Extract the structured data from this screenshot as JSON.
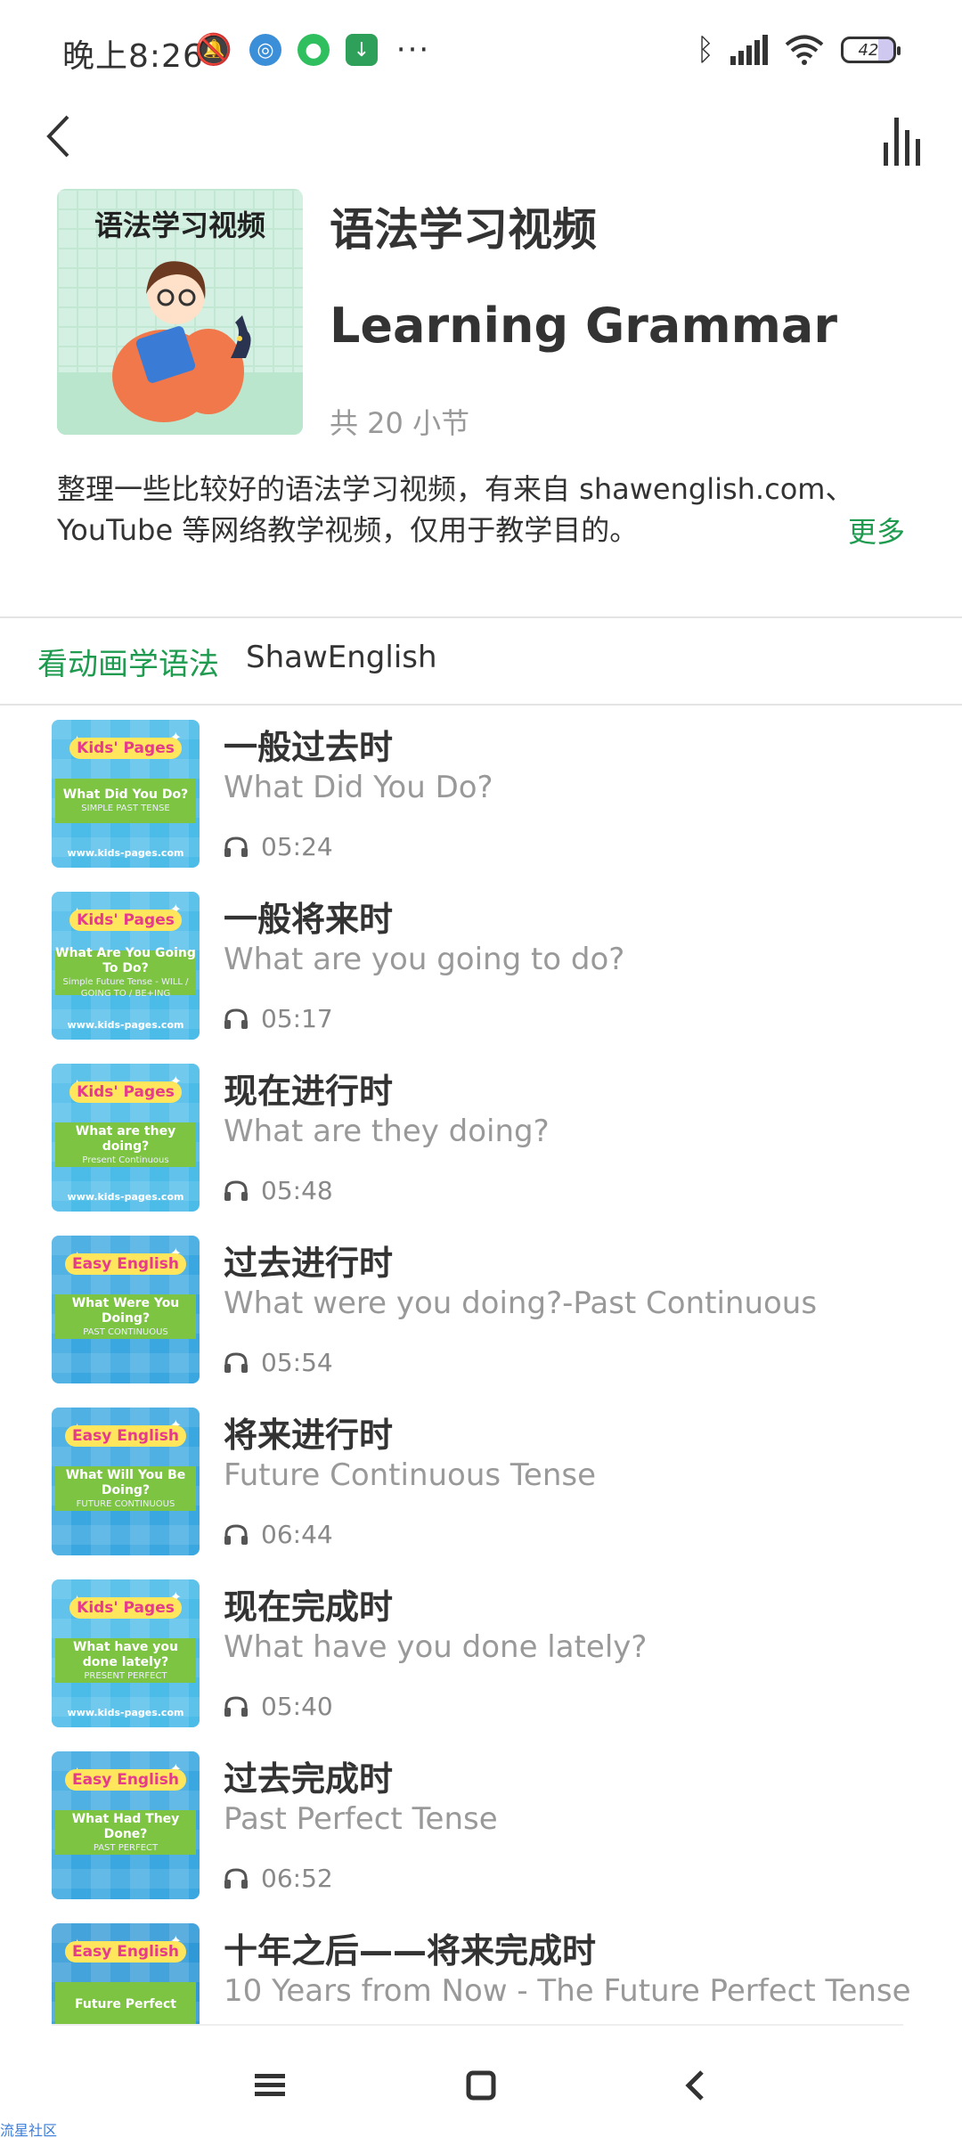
{
  "status_bar": {
    "time": "晚上8:26",
    "battery": "42",
    "icons_left": [
      "mute-icon",
      "browser-icon",
      "wechat-icon",
      "download-icon",
      "more-dots-icon"
    ],
    "icons_right": [
      "bluetooth-icon",
      "hd-signal-icon",
      "wifi-icon",
      "battery-icon"
    ]
  },
  "nav": {
    "back_icon": "chevron-left-icon",
    "player_icon": "equalizer-icon"
  },
  "course": {
    "cover_text": "语法学习视频",
    "title_cn": "语法学习视频",
    "title_en": "Learning Grammar",
    "lesson_count": "共 20 小节",
    "description": "整理一些比较好的语法学习视频，有来自 shawenglish.com、YouTube 等网络教学视频，仅用于教学目的。",
    "more": "更多"
  },
  "tabs": [
    {
      "label": "看动画学语法",
      "active": true
    },
    {
      "label": "ShawEnglish",
      "active": false
    }
  ],
  "lessons": [
    {
      "title": "一般过去时",
      "subtitle": "What Did You Do?",
      "duration": "05:24",
      "thumb_badge": "Kids' Pages",
      "thumb_title": "What Did You Do?",
      "thumb_sub": "SIMPLE PAST TENSE",
      "thumb_site": "www.kids-pages.com"
    },
    {
      "title": "一般将来时",
      "subtitle": "What are you going to do?",
      "duration": "05:17",
      "thumb_badge": "Kids' Pages",
      "thumb_title": "What Are You Going To Do?",
      "thumb_sub": "Simple Future Tense - WILL / GOING TO / BE+ING",
      "thumb_site": "www.kids-pages.com"
    },
    {
      "title": "现在进行时",
      "subtitle": "What are they doing?",
      "duration": "05:48",
      "thumb_badge": "Kids' Pages",
      "thumb_title": "What are they doing?",
      "thumb_sub": "Present Continuous",
      "thumb_site": "www.kids-pages.com"
    },
    {
      "title": "过去进行时",
      "subtitle": "What were you doing?-Past Continuous",
      "duration": "05:54",
      "thumb_badge": "Easy English",
      "thumb_title": "What Were You Doing?",
      "thumb_sub": "PAST CONTINUOUS",
      "thumb_site": ""
    },
    {
      "title": "将来进行时",
      "subtitle": "Future Continuous Tense",
      "duration": "06:44",
      "thumb_badge": "Easy English",
      "thumb_title": "What Will You Be Doing?",
      "thumb_sub": "FUTURE CONTINUOUS",
      "thumb_site": ""
    },
    {
      "title": "现在完成时",
      "subtitle": "What have you done lately?",
      "duration": "05:40",
      "thumb_badge": "Kids' Pages",
      "thumb_title": "What have you done lately?",
      "thumb_sub": "PRESENT PERFECT",
      "thumb_site": "www.kids-pages.com"
    },
    {
      "title": "过去完成时",
      "subtitle": "Past Perfect Tense",
      "duration": "06:52",
      "thumb_badge": "Easy English",
      "thumb_title": "What Had They Done?",
      "thumb_sub": "PAST PERFECT",
      "thumb_site": ""
    },
    {
      "title": "十年之后——将来完成时",
      "subtitle": "10 Years from Now - The Future Perfect Tense",
      "duration": "",
      "thumb_badge": "Easy English",
      "thumb_title": "Future Perfect",
      "thumb_sub": "",
      "thumb_site": ""
    }
  ],
  "navbar": {
    "buttons": [
      "menu-icon",
      "home-icon",
      "back-icon"
    ]
  },
  "watermark": "流星社区"
}
